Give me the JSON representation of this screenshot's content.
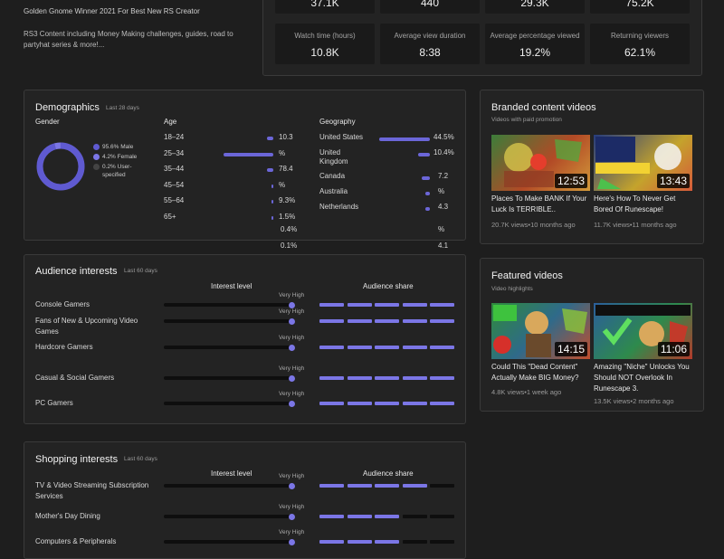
{
  "channel": {
    "line1": "Golden Gnome Winner 2021 For Best New RS Creator",
    "line2a": "RS3 Content including Money Making challenges, guides, road to",
    "line2b": "partyhat series & more!..."
  },
  "top_stats": [
    {
      "value": "37.1K"
    },
    {
      "value": "440"
    },
    {
      "value": "29.3K"
    },
    {
      "value": "75.2K"
    }
  ],
  "stats": [
    {
      "label": "Watch time (hours)",
      "value": "10.8K"
    },
    {
      "label": "Average view duration",
      "value": "8:38"
    },
    {
      "label": "Average percentage viewed",
      "value": "19.2%"
    },
    {
      "label": "Returning viewers",
      "value": "62.1%"
    }
  ],
  "demographics": {
    "title": "Demographics",
    "subtitle": "Last 28 days",
    "gender_label": "Gender",
    "gender": [
      {
        "label": "95.6% Male",
        "value": 95.6,
        "color": "#5f5ad1"
      },
      {
        "label": "4.2% Female",
        "value": 4.2,
        "color": "#7b76e6"
      },
      {
        "label": "0.2% User-",
        "label2": "specified",
        "value": 0.2,
        "color": "#444444"
      }
    ],
    "age_label": "Age",
    "ages": [
      {
        "label": "18–24",
        "pct": "10.3",
        "share": 10.3
      },
      {
        "label": "25–34",
        "pct": "%",
        "share": 78.4
      },
      {
        "label": "35–44",
        "pct": "78.4",
        "share": 9.3
      },
      {
        "label": "45–54",
        "pct": "%",
        "share": 1.5
      },
      {
        "label": "55–64",
        "pct": "9.3%",
        "share": 0.4
      },
      {
        "label": "65+",
        "pct": "1.5%",
        "share": 0.1
      }
    ],
    "age_extra": [
      "0.4%",
      "0.1%"
    ],
    "geo_label": "Geography",
    "geos": [
      {
        "label": "United States",
        "pct": "44.5%",
        "share": 44.5
      },
      {
        "label": "United",
        "label2": "Kingdom",
        "pct": "10.4%",
        "share": 10.4
      },
      {
        "label": "Canada",
        "pct": "7.2",
        "share": 7.2
      },
      {
        "label": "Australia",
        "pct": "%",
        "share": 4.3
      },
      {
        "label": "Netherlands",
        "pct": "4.3",
        "share": 4.1
      }
    ],
    "geo_extra": [
      "%",
      "4.1",
      "%"
    ]
  },
  "branded": {
    "title": "Branded content videos",
    "subtitle": "Videos with paid promotion",
    "videos": [
      {
        "title1": "Places To Make BANK If Your",
        "title2": "Luck Is TERRIBLE..",
        "meta": "20.7K views•10 months ago",
        "duration": "12:53"
      },
      {
        "title1": "Here's  How  To  Never  Get",
        "title2": "Bored Of Runescape!",
        "meta": "11.7K views•11 months ago",
        "duration": "13:43"
      }
    ]
  },
  "featured": {
    "title": "Featured videos",
    "subtitle": "Video highlights",
    "videos": [
      {
        "title1": "Could This \"Dead Content\"",
        "title2": "Actually Make BIG Money?",
        "meta": "4.8K views•1 week ago",
        "duration": "14:15"
      },
      {
        "title1": "Amazing \"Niche\" Unlocks You",
        "title2": "Should NOT Overlook In",
        "title3": "Runescape 3.",
        "meta": "13.5K views•2 months ago",
        "duration": "11:06"
      }
    ]
  },
  "audience": {
    "title": "Audience interests",
    "subtitle": "Last 60 days",
    "col_interest": "Interest level",
    "col_share": "Audience share",
    "high_label": "Very High",
    "rows": [
      {
        "label": "Console Gamers",
        "level": 0.98,
        "share": 1.0
      },
      {
        "label": "Fans of New & Upcoming Video",
        "label2": "Games",
        "level": 0.98,
        "share": 1.0
      },
      {
        "label": "Hardcore Gamers",
        "level": 0.98,
        "share": 1.0
      },
      {
        "label": "Casual & Social Gamers",
        "level": 0.98,
        "share": 1.0
      },
      {
        "label": "PC Gamers",
        "level": 0.98,
        "share": 1.0
      }
    ]
  },
  "shopping": {
    "title": "Shopping interests",
    "subtitle": "Last 60 days",
    "col_interest": "Interest level",
    "col_share": "Audience share",
    "high_label": "Very High",
    "rows": [
      {
        "label": "TV & Video Streaming Subscription",
        "label2": "Services",
        "level": 0.98,
        "share": 0.8
      },
      {
        "label": "Mother's Day Dining",
        "level": 0.98,
        "share": 0.6
      },
      {
        "label": "Computers & Peripherals",
        "level": 0.98,
        "share": 0.6
      }
    ]
  },
  "colors": {
    "accent": "#7b76e6",
    "donut": "#5f5ad1",
    "track": "#0e0e0e"
  }
}
